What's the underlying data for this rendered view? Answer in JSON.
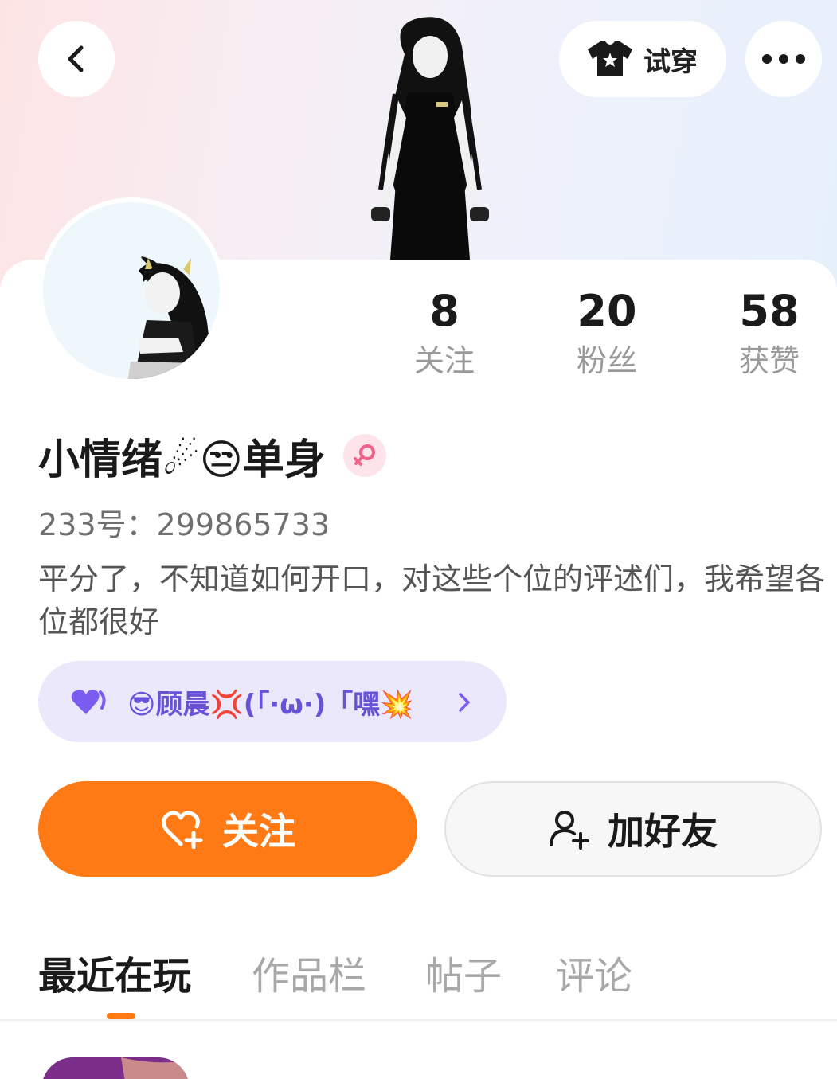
{
  "header": {
    "try_on_label": "试穿",
    "icons": {
      "back": "chevron-left-icon",
      "try_on": "tshirt-icon",
      "more": "more-dots-icon"
    }
  },
  "profile": {
    "name": "小情绪☄😒单身",
    "gender": "female",
    "uid": "233号：299865733",
    "bio": "平分了，不知道如何开口，对这些个位的评述们，我希望各位都很好",
    "stats": [
      {
        "value": "8",
        "label": "关注"
      },
      {
        "value": "20",
        "label": "粉丝"
      },
      {
        "value": "58",
        "label": "获赞"
      }
    ]
  },
  "guild": {
    "text": "😎顾晨💢(「·ω·)「嘿💥",
    "icon": "purple-heart-icon"
  },
  "actions": {
    "follow_label": "关注",
    "add_friend_label": "加好友"
  },
  "tabs": [
    {
      "label": "最近在玩",
      "active": true
    },
    {
      "label": "作品栏",
      "active": false
    },
    {
      "label": "帖子",
      "active": false
    },
    {
      "label": "评论",
      "active": false
    }
  ],
  "colors": {
    "accent": "#ff7a14",
    "guild_bg": "#ebe8fb",
    "guild_text": "#6a52d8",
    "gender_badge": "#fde4ea"
  }
}
